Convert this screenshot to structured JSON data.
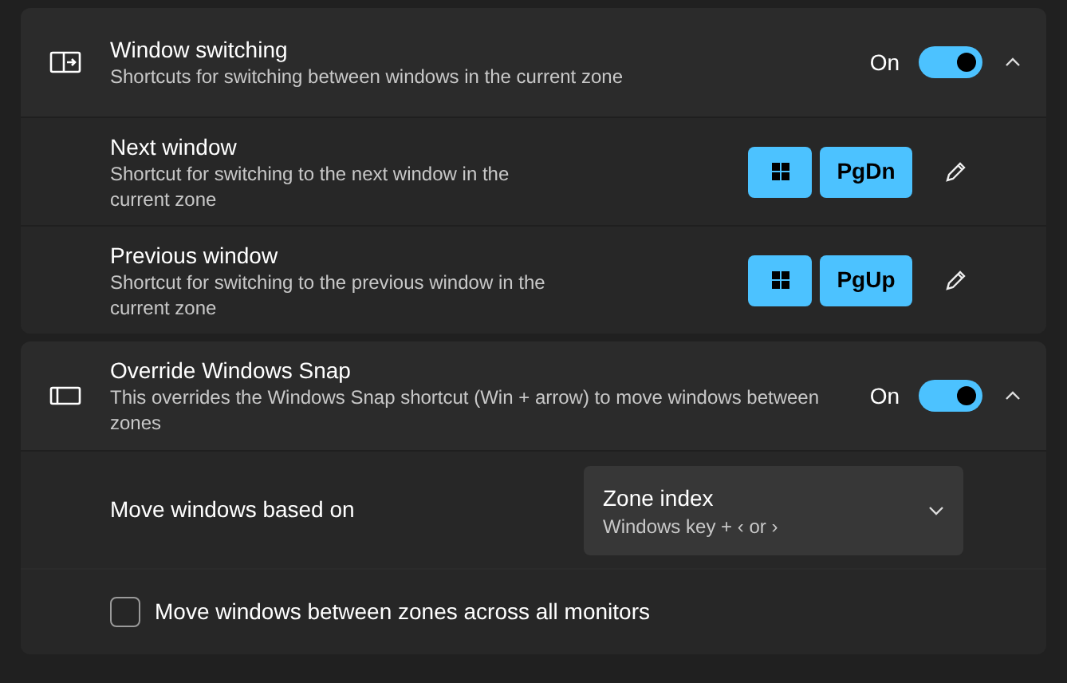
{
  "sections": [
    {
      "kind": "window-switch",
      "title": "Window switching",
      "description": "Shortcuts for switching between windows in the current zone",
      "state_label": "On",
      "on": true,
      "expanded": true,
      "rows": [
        {
          "kind": "shortcut",
          "title": "Next window",
          "description": "Shortcut for switching to the next window in the current zone",
          "keys": [
            {
              "kind": "windows"
            },
            {
              "kind": "text",
              "label": "PgDn"
            }
          ]
        },
        {
          "kind": "shortcut",
          "title": "Previous window",
          "description": "Shortcut for switching to the previous window in the current zone",
          "keys": [
            {
              "kind": "windows"
            },
            {
              "kind": "text",
              "label": "PgUp"
            }
          ]
        }
      ]
    },
    {
      "kind": "snap",
      "title": "Override Windows Snap",
      "description": "This overrides the Windows Snap shortcut (Win + arrow) to move windows between zones",
      "state_label": "On",
      "on": true,
      "expanded": true,
      "rows": [
        {
          "kind": "dropdown",
          "title": "Move windows based on",
          "value": "Zone index",
          "hint": "Windows key + ‹ or ›"
        },
        {
          "kind": "checkbox",
          "title": "Move windows between zones across all monitors",
          "checked": false
        }
      ]
    }
  ]
}
